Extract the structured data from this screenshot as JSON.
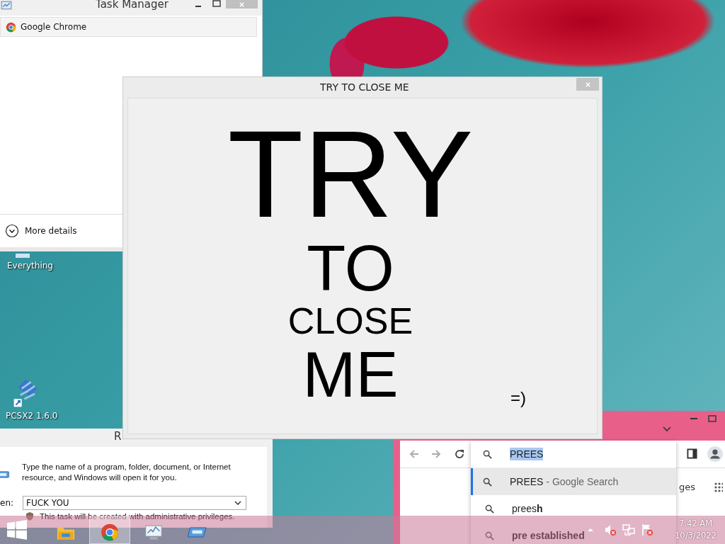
{
  "task_manager": {
    "title": "Task Manager",
    "processes": [
      {
        "name": "Google Chrome",
        "selected": true
      }
    ],
    "more_details": "More details"
  },
  "desktop_icons": [
    {
      "kind": "everything",
      "label": "Everything"
    },
    {
      "kind": "pcsx2",
      "label": "PCSX2 1.6.0"
    }
  ],
  "run_dialog": {
    "title": "R",
    "description": "Type the name of a program, folder, document, or Internet resource, and Windows will open it for you.",
    "open_label": "en:",
    "open_value": "FUCK YOU",
    "admin_note": "This task will be created with administrative privileges."
  },
  "prank_window": {
    "title": "TRY TO CLOSE ME",
    "lines": [
      "TRY",
      "TO",
      "CLOSE",
      "ME"
    ],
    "smiley": "=)"
  },
  "chrome": {
    "omnibox": {
      "text": "PREES",
      "selected": true
    },
    "suggestions": [
      {
        "text": "PREES",
        "suffix": " - Google Search",
        "selected": true,
        "emphasized": false
      },
      {
        "text": "prees**h**",
        "selected": false,
        "emphasized": false
      },
      {
        "text": "pre established",
        "selected": false,
        "emphasized": true
      }
    ],
    "page_text": "ges"
  },
  "taskbar": {
    "apps": [
      {
        "kind": "explorer",
        "active": false
      },
      {
        "kind": "chrome",
        "active": true
      },
      {
        "kind": "taskmgr",
        "active": false
      },
      {
        "kind": "run",
        "active": false
      }
    ],
    "time": "7:42 AM",
    "date": "10/3/2022"
  }
}
